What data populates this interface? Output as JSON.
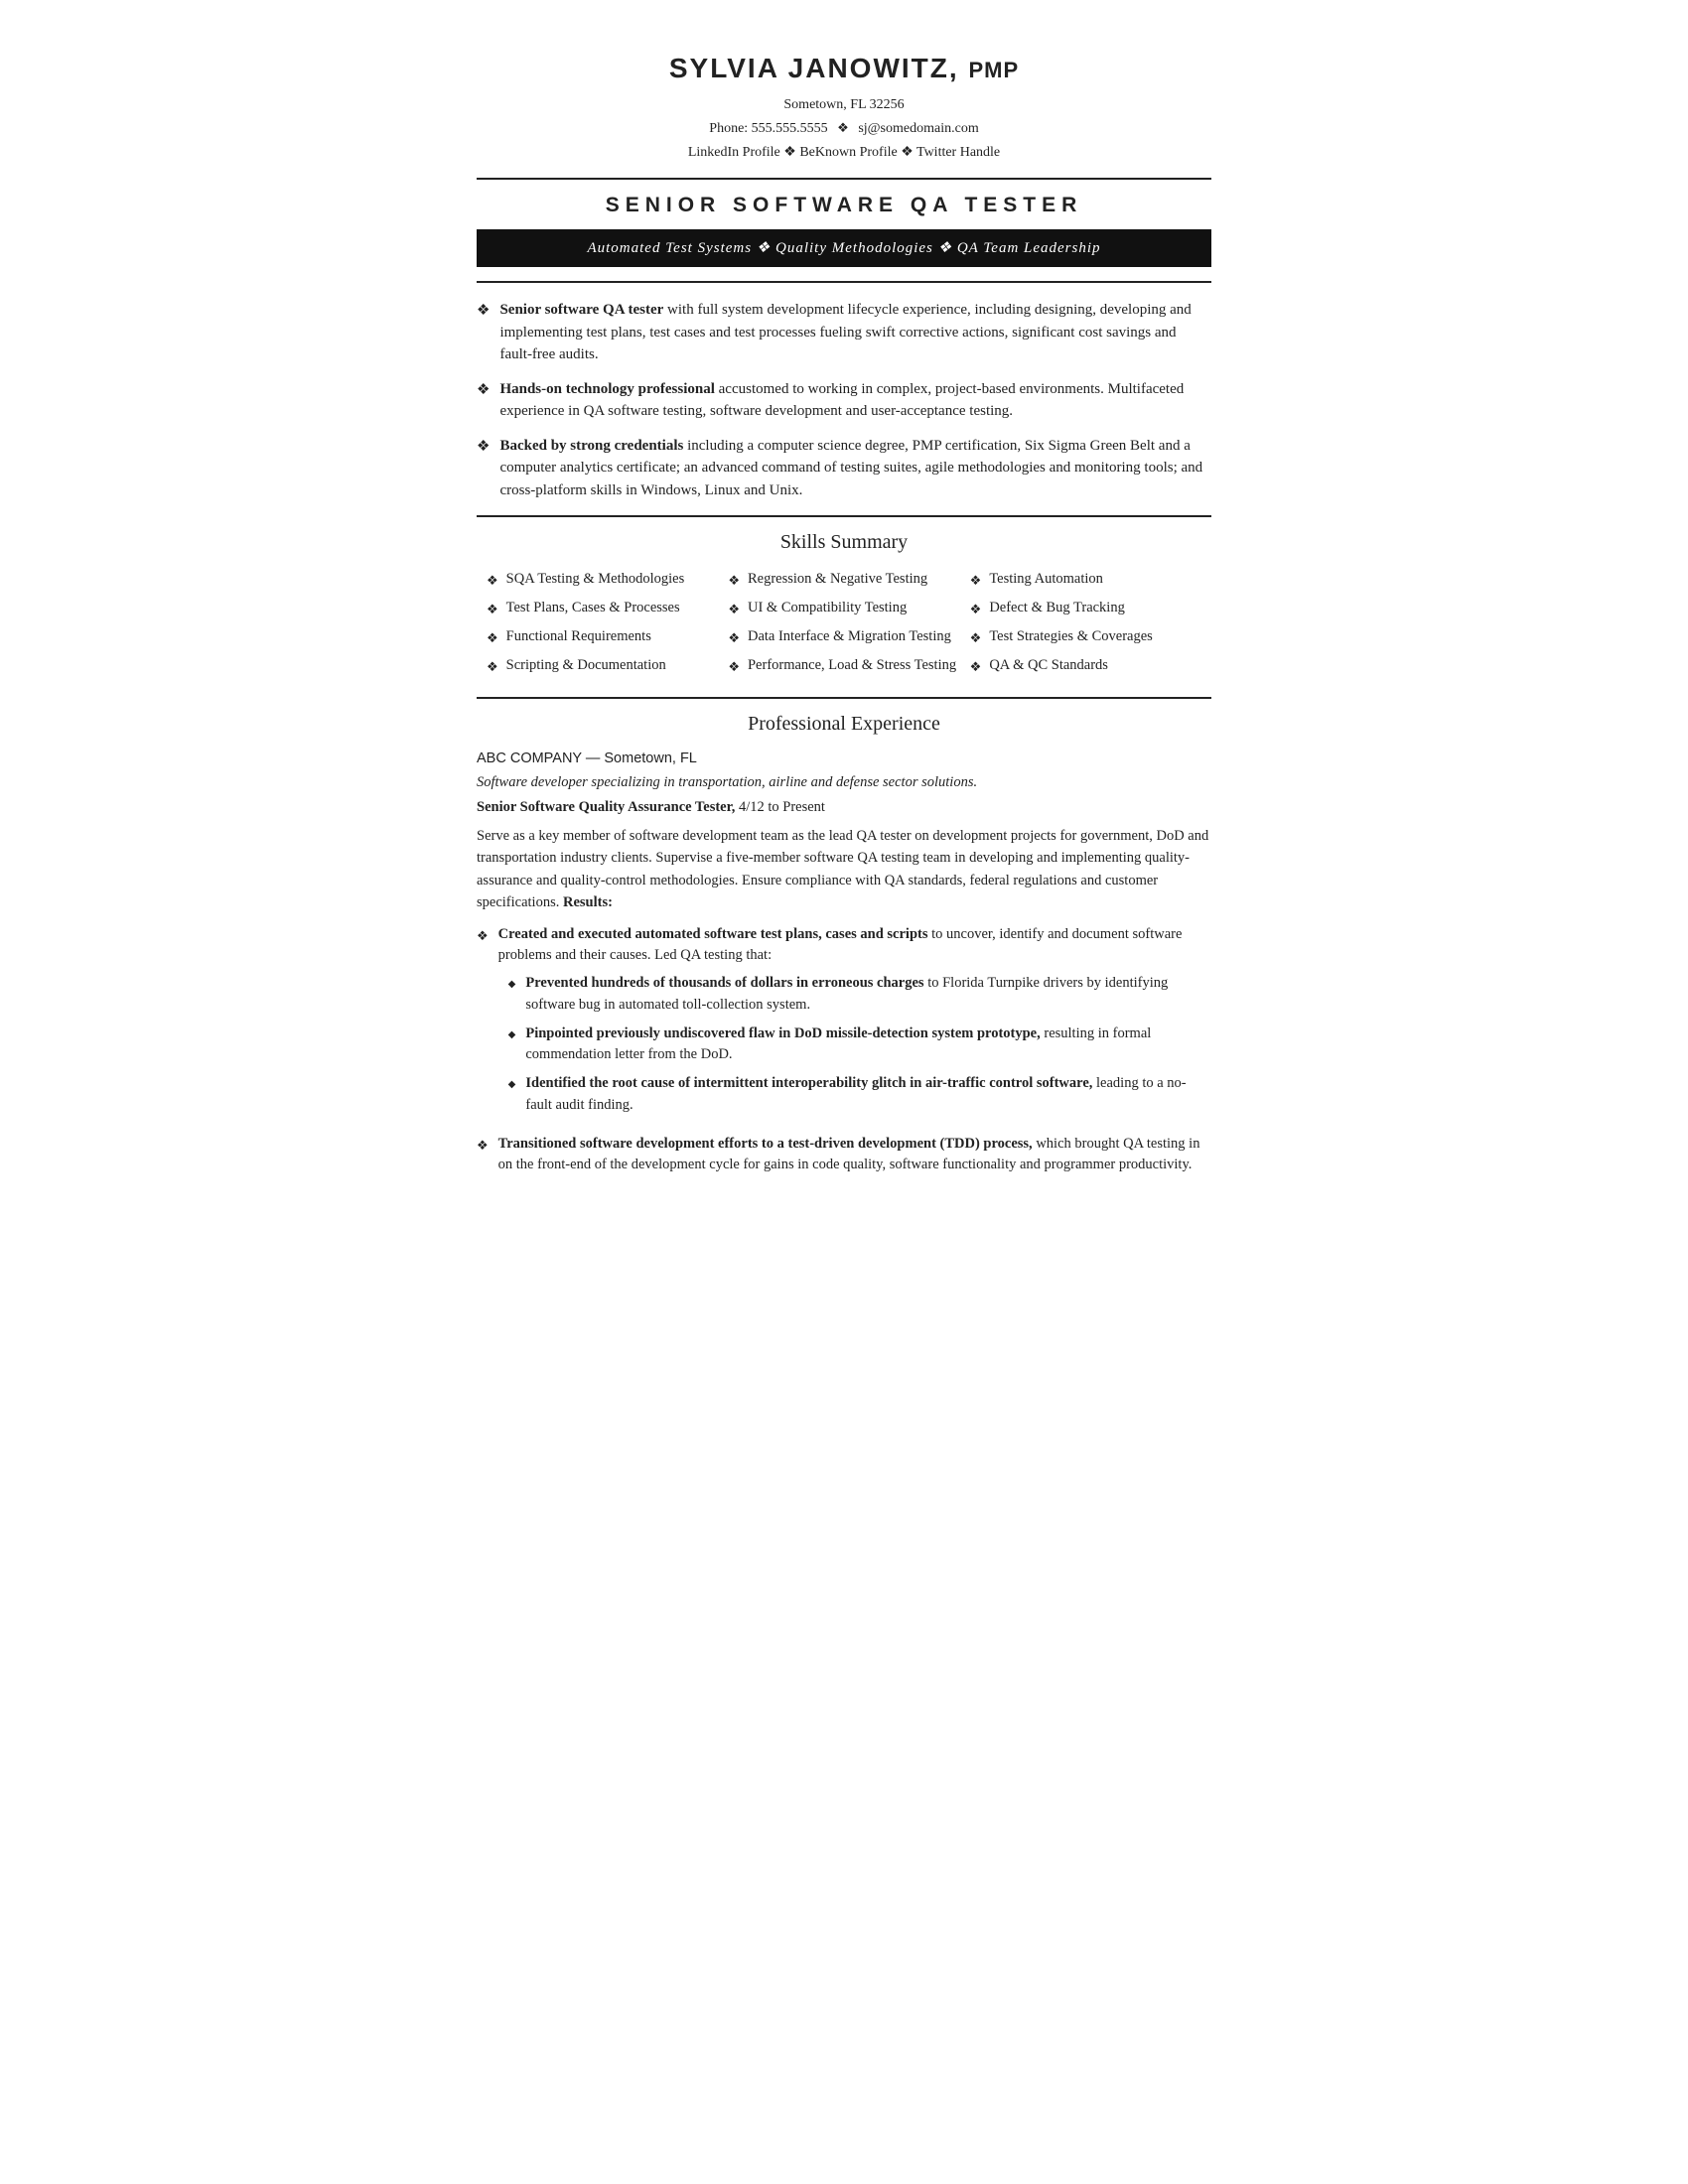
{
  "header": {
    "name": "SYLVIA JANOWITZ,",
    "credential": "PMP",
    "address": "Sometown, FL 32256",
    "phone_label": "Phone:",
    "phone": "555.555.5555",
    "diamond1": "❖",
    "email": "sj@somedomain.com",
    "diamond2": "❖",
    "links_line": "LinkedIn Profile ❖ BeKnown Profile ❖ Twitter Handle"
  },
  "title": {
    "text": "SENIOR SOFTWARE QA TESTER",
    "banner": "Automated Test Systems ❖ Quality Methodologies ❖ QA Team Leadership"
  },
  "summary": {
    "items": [
      {
        "bold": "Senior software QA tester",
        "text": " with full system development lifecycle experience, including designing, developing and implementing test plans, test cases and test processes fueling swift corrective actions, significant cost savings and fault-free audits."
      },
      {
        "bold": "Hands-on technology professional",
        "text": " accustomed to working in complex, project-based environments. Multifaceted experience in QA software testing, software development and user-acceptance testing."
      },
      {
        "bold": "Backed by strong credentials",
        "text": " including a computer science degree, PMP certification, Six Sigma Green Belt and a computer analytics certificate; an advanced command of testing suites, agile methodologies and monitoring tools; and cross-platform skills in Windows, Linux and Unix."
      }
    ]
  },
  "skills": {
    "section_title": "Skills Summary",
    "columns": [
      [
        "SQA Testing & Methodologies",
        "Test Plans, Cases & Processes",
        "Functional Requirements",
        "Scripting & Documentation"
      ],
      [
        "Regression & Negative Testing",
        "UI & Compatibility Testing",
        "Data Interface & Migration Testing",
        "Performance, Load & Stress Testing"
      ],
      [
        "Testing Automation",
        "Defect & Bug Tracking",
        "Test Strategies & Coverages",
        "QA & QC Standards"
      ]
    ]
  },
  "experience": {
    "section_title": "Professional Experience",
    "company": "ABC COMPANY — Sometown, FL",
    "company_desc": "Software developer specializing in transportation, airline and defense sector solutions.",
    "job_title": "Senior Software Quality Assurance Tester,",
    "job_date": " 4/12 to Present",
    "job_desc": "Serve as a key member of software development team as the lead QA tester on development projects for government, DoD and transportation industry clients. Supervise a five-member software QA testing team in developing and implementing quality-assurance and quality-control methodologies. Ensure compliance with QA standards, federal regulations and customer specifications.",
    "results_label": "Results:",
    "bullet1_bold": "Created and executed automated software test plans, cases and scripts",
    "bullet1_text": " to uncover, identify and document software problems and their causes. Led QA testing that:",
    "sub_bullets": [
      {
        "bold": "Prevented hundreds of thousands of dollars in erroneous charges",
        "text": " to Florida Turnpike drivers by identifying software bug in automated toll-collection system."
      },
      {
        "bold": "Pinpointed previously undiscovered flaw in DoD missile-detection system prototype,",
        "text": " resulting in formal commendation letter from the DoD."
      },
      {
        "bold": "Identified the root cause of intermittent interoperability glitch in air-traffic control software,",
        "text": " leading to a no-fault audit finding."
      }
    ],
    "bullet2_bold": "Transitioned software development efforts to a test-driven development (TDD) process,",
    "bullet2_text": " which brought QA testing in on the front-end of the development cycle for gains in code quality, software functionality and programmer productivity."
  },
  "diamond": "❖",
  "sub_diamond": "◆"
}
